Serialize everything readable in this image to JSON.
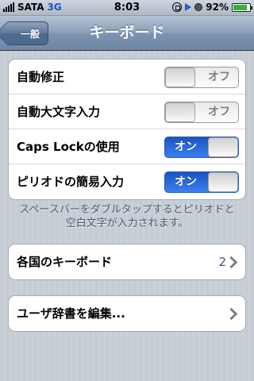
{
  "status_bar": {
    "carrier": "SATA",
    "network": "3G",
    "time": "8:03",
    "battery_percent": "92%",
    "battery_level": 0.92,
    "icons": [
      "signal-icon",
      "orientation-lock-icon",
      "play-icon",
      "alarm-icon",
      "battery-icon"
    ]
  },
  "nav": {
    "back_label": "一般",
    "title": "キーボード"
  },
  "toggles": [
    {
      "label": "自動修正",
      "state_text": "オフ",
      "on": false
    },
    {
      "label": "自動大文字入力",
      "state_text": "オフ",
      "on": false
    },
    {
      "label": "Caps Lockの使用",
      "state_text": "オン",
      "on": true
    },
    {
      "label": "ピリオドの簡易入力",
      "state_text": "オン",
      "on": true
    }
  ],
  "footnote": "スペースバーをダブルタップするとピリオドと空白文字が入力されます。",
  "international": {
    "label": "各国のキーボード",
    "value": "2"
  },
  "dictionary": {
    "label": "ユーザ辞書を編集..."
  },
  "colors": {
    "switch_on": "#2f6fe0",
    "value_text": "#385487",
    "navbar": "#6d86a5"
  }
}
